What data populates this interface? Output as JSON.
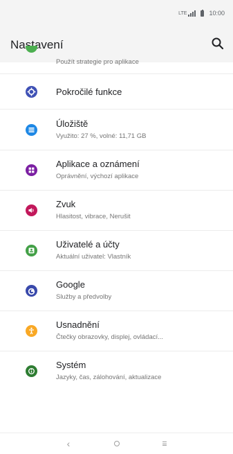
{
  "status_bar": {
    "network": "LTE",
    "time": "10:00"
  },
  "app_bar": {
    "title": "Nastavení"
  },
  "items": [
    {
      "title": "",
      "subtitle": "Použít strategie pro aplikace",
      "color": "#4caf50",
      "icon": "partial-green-icon"
    },
    {
      "title": "Pokročilé funkce",
      "subtitle": "",
      "color": "#3f51b5",
      "icon": "settings-plus-icon"
    },
    {
      "title": "Úložiště",
      "subtitle": "Využito: 27 %, volné: 11,71 GB",
      "color": "#1e88e5",
      "icon": "storage-icon"
    },
    {
      "title": "Aplikace a oznámení",
      "subtitle": "Oprávnění, výchozí aplikace",
      "color": "#7b1fa2",
      "icon": "apps-icon"
    },
    {
      "title": "Zvuk",
      "subtitle": "Hlasitost, vibrace, Nerušit",
      "color": "#c2185b",
      "icon": "volume-icon"
    },
    {
      "title": "Uživatelé a účty",
      "subtitle": "Aktuální uživatel: Vlastník",
      "color": "#43a047",
      "icon": "account-icon"
    },
    {
      "title": "Google",
      "subtitle": "Služby a předvolby",
      "color": "#3949ab",
      "icon": "google-icon"
    },
    {
      "title": "Usnadnění",
      "subtitle": "Čtečky obrazovky, displej, ovládací...",
      "color": "#f9a825",
      "icon": "accessibility-icon"
    },
    {
      "title": "Systém",
      "subtitle": "Jazyky, čas, zálohování, aktualizace",
      "color": "#2e7d32",
      "icon": "info-icon"
    }
  ],
  "nav_bar": {
    "back": "‹",
    "home": "○",
    "menu": "≡"
  }
}
